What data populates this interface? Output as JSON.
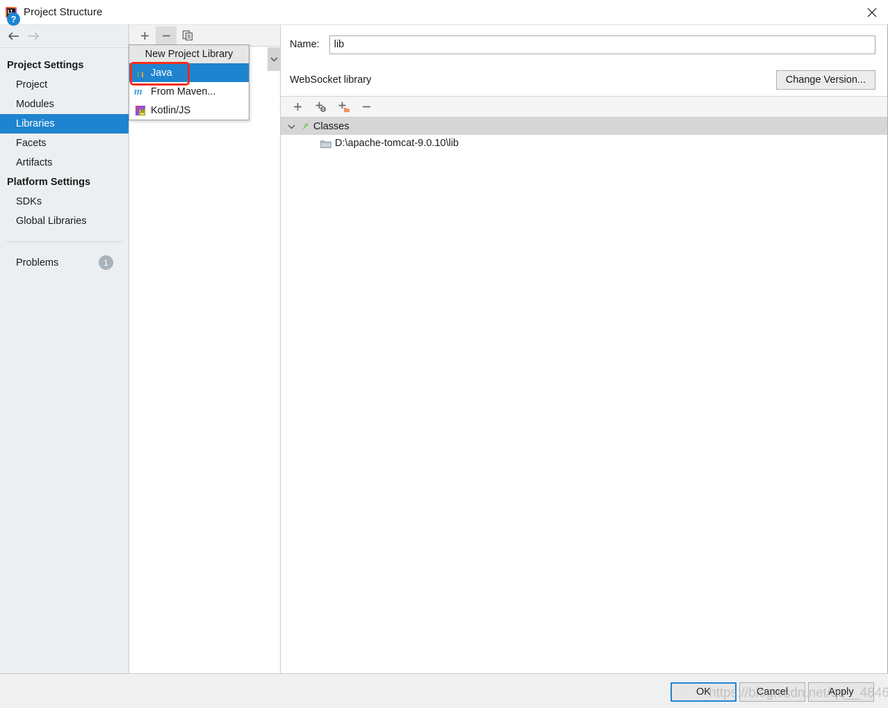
{
  "window": {
    "title": "Project Structure",
    "app_icon": "intellij-idea-icon",
    "close_icon": "close-icon"
  },
  "nav": {
    "back_icon": "arrow-left-icon",
    "forward_icon": "arrow-right-icon"
  },
  "sidebar": {
    "groups": [
      {
        "header": "Project Settings",
        "items": [
          {
            "label": "Project",
            "selected": false
          },
          {
            "label": "Modules",
            "selected": false
          },
          {
            "label": "Libraries",
            "selected": true
          },
          {
            "label": "Facets",
            "selected": false
          },
          {
            "label": "Artifacts",
            "selected": false
          }
        ]
      },
      {
        "header": "Platform Settings",
        "items": [
          {
            "label": "SDKs",
            "selected": false
          },
          {
            "label": "Global Libraries",
            "selected": false
          }
        ]
      }
    ],
    "problems": {
      "label": "Problems",
      "count": "1"
    }
  },
  "mid_toolbar": {
    "add_icon": "plus-icon",
    "remove_icon": "minus-icon",
    "copy_icon": "copy-icon"
  },
  "dropdown": {
    "header": "New Project Library",
    "items": [
      {
        "label": "Java",
        "icon": "java-icon",
        "highlighted": true
      },
      {
        "label": "From Maven...",
        "icon": "maven-icon",
        "highlighted": false
      },
      {
        "label": "Kotlin/JS",
        "icon": "kotlin-js-icon",
        "highlighted": false
      }
    ]
  },
  "detail": {
    "name_label": "Name:",
    "name_value": "lib",
    "name_placeholder": "",
    "library_type": "WebSocket library",
    "change_version_label": "Change Version..."
  },
  "tree_toolbar": {
    "icons": [
      "plus-icon",
      "plus-url-icon",
      "plus-folder-icon",
      "minus-icon"
    ]
  },
  "tree": {
    "root": {
      "label": "Classes",
      "icon": "classes-folder-icon",
      "chevron": "chevron-down-icon"
    },
    "children": [
      {
        "label": "D:\\apache-tomcat-9.0.10\\lib",
        "icon": "folder-icon"
      }
    ]
  },
  "footer": {
    "help_icon": "help-icon",
    "help_label": "?",
    "ok_label": "OK",
    "cancel_label": "Cancel",
    "apply_label": "Apply",
    "watermark": "https://blog.csdn.net/qq__4846"
  },
  "colors": {
    "accent": "#1f84d0",
    "sidebar_bg": "#eceff1",
    "highlight_ring": "#fa2c19",
    "badge_bg": "#a8b3bb"
  }
}
